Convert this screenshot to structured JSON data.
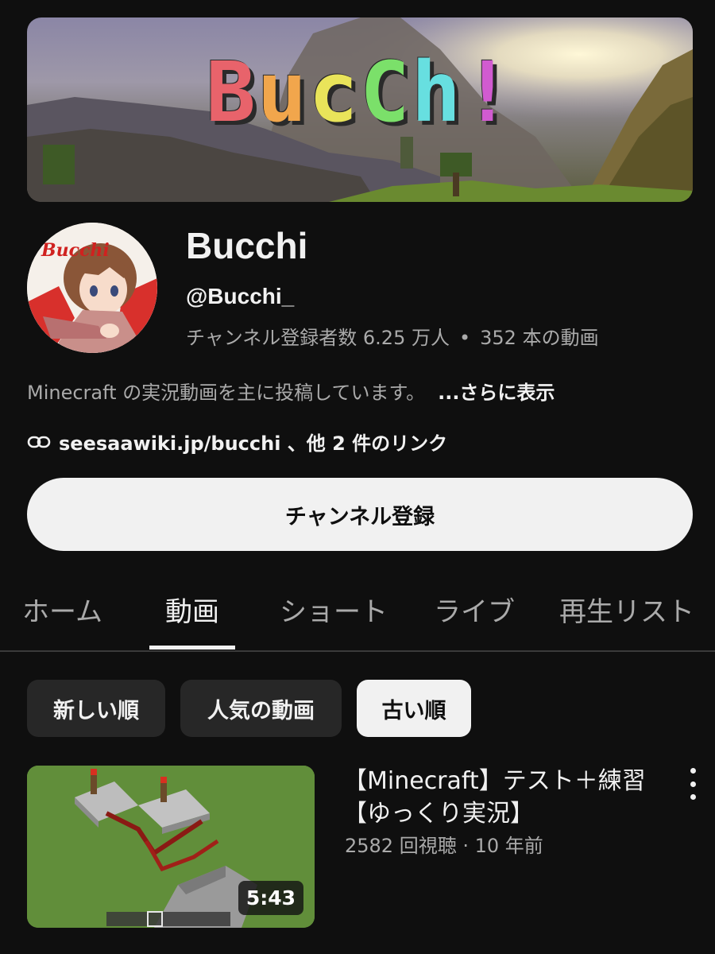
{
  "banner": {
    "title_letters": [
      {
        "char": "B",
        "color": "#e8636b"
      },
      {
        "char": "u",
        "color": "#f1a64c"
      },
      {
        "char": "c",
        "color": "#e9e45a"
      },
      {
        "char": "C",
        "color": "#7be06a"
      },
      {
        "char": "h",
        "color": "#67dfe0"
      },
      {
        "char": "!",
        "color": "#d15bd0"
      }
    ]
  },
  "channel": {
    "avatar_text": "Bucchi",
    "name": "Bucchi",
    "handle": "@Bucchi_",
    "subscribers": "チャンネル登録者数 6.25 万人",
    "separator": "•",
    "video_count": "352 本の動画",
    "description": "Minecraft の実況動画を主に投稿しています。",
    "more_label": "...さらに表示",
    "links_text": "seesaawiki.jp/bucchi 、他 2 件のリンク",
    "subscribe_label": "チャンネル登録"
  },
  "tabs": [
    {
      "label": "ホーム"
    },
    {
      "label": "動画"
    },
    {
      "label": "ショート"
    },
    {
      "label": "ライブ"
    },
    {
      "label": "再生リスト"
    }
  ],
  "active_tab": "動画",
  "chips": [
    {
      "label": "新しい順"
    },
    {
      "label": "人気の動画"
    },
    {
      "label": "古い順"
    }
  ],
  "selected_chip": "古い順",
  "video": {
    "title": "【Minecraft】テスト＋練習【ゆっくり実況】",
    "meta": "2582 回視聴 · 10 年前",
    "duration": "5:43"
  },
  "icons": {
    "link": "link-icon",
    "more": "more-vertical-icon"
  },
  "colors": {
    "background": "#0f0f0f",
    "text_primary": "#f1f1f1",
    "text_secondary": "#aaaaaa",
    "chip_bg": "#272727"
  }
}
